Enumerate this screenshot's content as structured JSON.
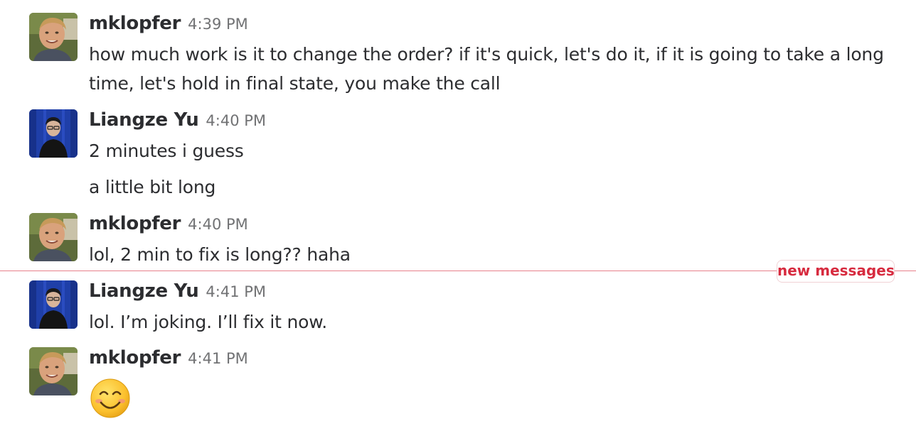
{
  "messages": [
    {
      "author": "mklopfer",
      "time": "4:39 PM",
      "lines": [
        "how much work is it to change the order?  if it's quick, let's do it, if it is going to take a long time, let's hold in final state, you make the call"
      ]
    },
    {
      "author": "Liangze Yu",
      "time": "4:40 PM",
      "lines": [
        "2 minutes i guess",
        "a little bit long"
      ]
    },
    {
      "author": "mklopfer",
      "time": "4:40 PM",
      "lines": [
        "lol, 2 min to fix is long??  haha"
      ]
    },
    {
      "author": "Liangze Yu",
      "time": "4:41 PM",
      "lines": [
        "lol. I’m joking. I’ll fix it now."
      ]
    },
    {
      "author": "mklopfer",
      "time": "4:41 PM",
      "emoji": "smiling-face-emoji"
    }
  ],
  "divider": {
    "label": "new messages",
    "color": "#d72b3f",
    "line_color": "#e8808b"
  },
  "colors": {
    "text": "#2c2d30",
    "timestamp": "#717274"
  }
}
